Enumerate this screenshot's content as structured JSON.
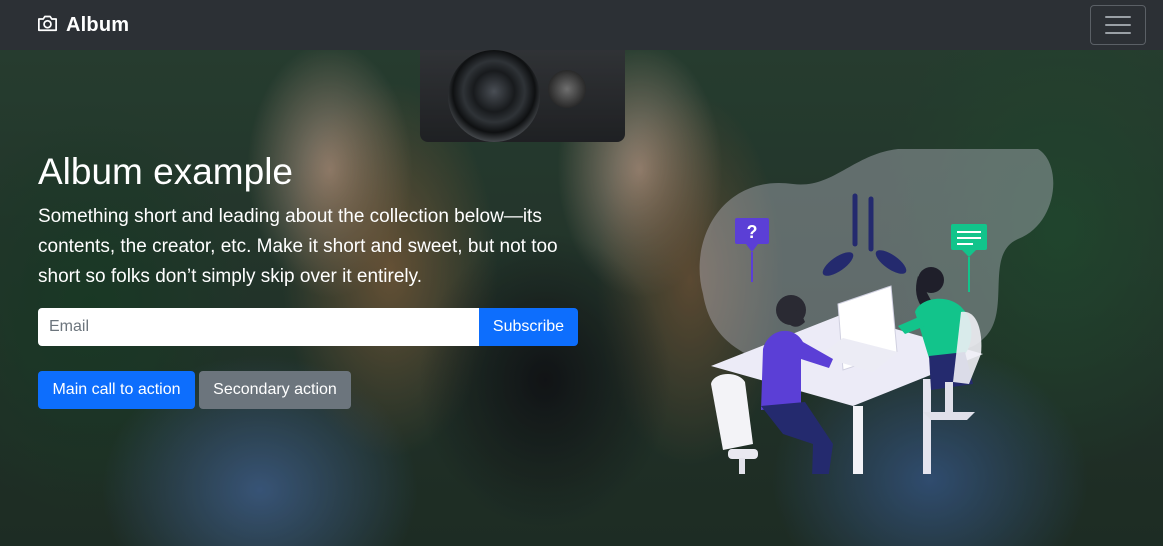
{
  "navbar": {
    "brand": "Album",
    "brand_icon": "camera-icon",
    "toggle_icon": "hamburger-icon"
  },
  "hero": {
    "title": "Album example",
    "lead": "Something short and leading about the collection below—its contents, the creator, etc. Make it short and sweet, but not too short so folks don’t simply skip over it entirely.",
    "email_placeholder": "Email",
    "subscribe_label": "Subscribe",
    "primary_action": "Main call to action",
    "secondary_action": "Secondary action"
  },
  "colors": {
    "navbar_bg": "#2c3035",
    "primary": "#0d6efd",
    "secondary": "#6c757d"
  }
}
